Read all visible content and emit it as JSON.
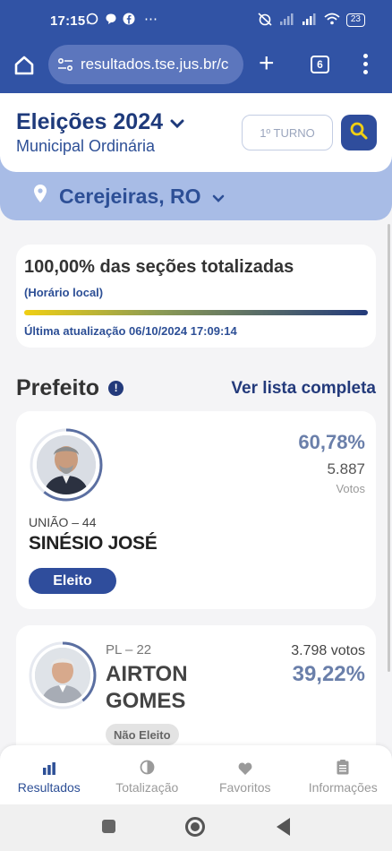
{
  "status_bar": {
    "time": "17:15",
    "battery": "23",
    "more_icon": "⋯"
  },
  "browser": {
    "url": "resultados.tse.jus.br/c",
    "tab_count": "6"
  },
  "header": {
    "title": "Eleições 2024",
    "subtitle": "Municipal Ordinária",
    "turn_button": "1º TURNO"
  },
  "location": {
    "name": "Cerejeiras, RO"
  },
  "progress": {
    "title": "100,00% das seções totalizadas",
    "local_time_label": "(Horário local)",
    "fraction_counted": 1.0,
    "last_update": "Última atualização 06/10/2024 17:09:14"
  },
  "section": {
    "title": "Prefeito",
    "info_icon": "!",
    "see_all": "Ver lista completa"
  },
  "candidates": [
    {
      "party": "UNIÃO – 44",
      "name": "SINÉSIO JOSÉ",
      "percent": "60,78%",
      "votes": "5.887",
      "votes_label": "Votos",
      "status": "Eleito",
      "vote_share": 0.6078
    },
    {
      "party": "PL – 22",
      "name": "AIRTON GOMES",
      "percent": "39,22%",
      "votes": "3.798 votos",
      "status": "Não Eleito",
      "vote_share": 0.3922
    }
  ],
  "bottom_nav": {
    "items": [
      {
        "label": "Resultados",
        "icon": "bar-chart-icon"
      },
      {
        "label": "Totalização",
        "icon": "pie-icon"
      },
      {
        "label": "Favoritos",
        "icon": "heart-icon"
      },
      {
        "label": "Informações",
        "icon": "clipboard-icon"
      }
    ]
  },
  "colors": {
    "brand": "#3153a5",
    "dark_blue": "#233a7b",
    "accent_yellow": "#f0cf14"
  }
}
